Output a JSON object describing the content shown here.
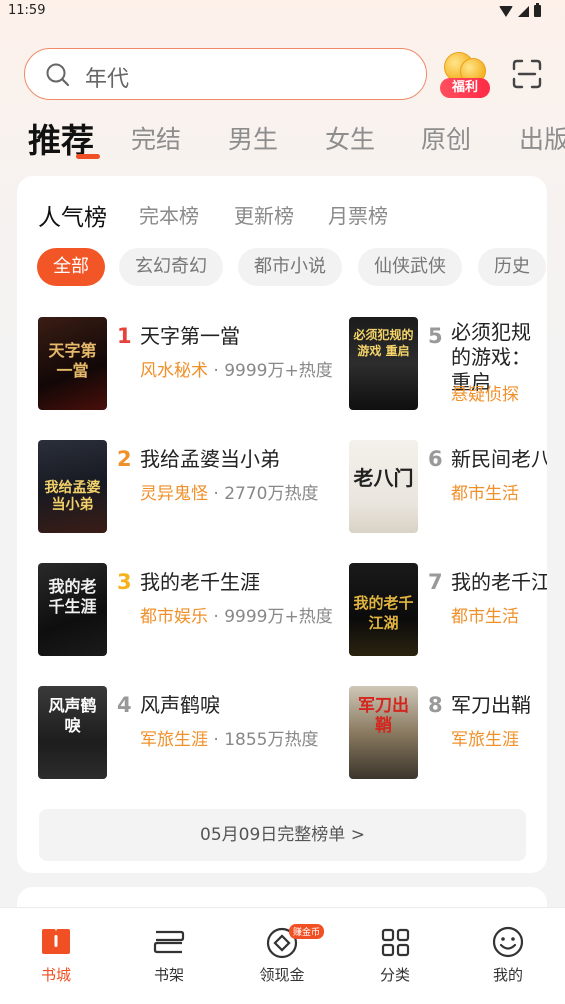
{
  "status_bar": {
    "time": "11:59"
  },
  "search": {
    "placeholder": "年代",
    "welfare_badge": "福利"
  },
  "main_tabs": [
    "推荐",
    "完结",
    "男生",
    "女生",
    "原创",
    "出版"
  ],
  "rank_tabs": [
    "人气榜",
    "完本榜",
    "更新榜",
    "月票榜"
  ],
  "chips": [
    "全部",
    "玄幻奇幻",
    "都市小说",
    "仙侠武侠",
    "历史"
  ],
  "books": [
    {
      "rank": "1",
      "title": "天字第一當",
      "genre": "风水秘术",
      "heat": "9999万+热度",
      "cover_text": "天字第一當"
    },
    {
      "rank": "2",
      "title": "我给孟婆当小弟",
      "genre": "灵异鬼怪",
      "heat": "2770万热度",
      "cover_text": "我给孟婆当小弟"
    },
    {
      "rank": "3",
      "title": "我的老千生涯",
      "genre": "都市娱乐",
      "heat": "9999万+热度",
      "cover_text": "我的老千生涯"
    },
    {
      "rank": "4",
      "title": "风声鹤唳",
      "genre": "军旅生涯",
      "heat": "1855万热度",
      "cover_text": "风声鹤唳"
    },
    {
      "rank": "5",
      "title": "必须犯规的游戏：重启",
      "genre": "悬疑侦探",
      "heat": "",
      "cover_text": "必须犯规的游戏 重启"
    },
    {
      "rank": "6",
      "title": "新民间老八门",
      "genre": "都市生活",
      "heat": "",
      "cover_text": "老八门"
    },
    {
      "rank": "7",
      "title": "我的老千江湖",
      "genre": "都市生活",
      "heat": "",
      "cover_text": "我的老千 江湖"
    },
    {
      "rank": "8",
      "title": "军刀出鞘",
      "genre": "军旅生涯",
      "heat": "",
      "cover_text": "军刀出鞘"
    }
  ],
  "full_list_label": "05月09日完整榜单 >",
  "bottom_nav": [
    {
      "label": "书城",
      "icon": "bookstore-icon"
    },
    {
      "label": "书架",
      "icon": "bookshelf-icon"
    },
    {
      "label": "领现金",
      "icon": "cash-icon",
      "badge": "赚金币"
    },
    {
      "label": "分类",
      "icon": "category-icon"
    },
    {
      "label": "我的",
      "icon": "profile-icon"
    }
  ],
  "colors": {
    "accent": "#f05023",
    "genre": "#f0902a",
    "rank_top": "#e8403a",
    "rank_2": "#f0902a",
    "rank_3": "#f5b21b",
    "rank_other": "#999999"
  }
}
